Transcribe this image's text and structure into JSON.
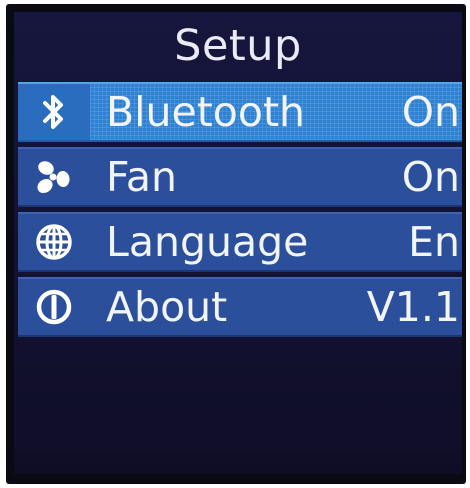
{
  "screen": {
    "title": "Setup"
  },
  "menu": {
    "items": [
      {
        "label": "Bluetooth",
        "value": "On",
        "icon": "bluetooth-icon",
        "selected": true
      },
      {
        "label": "Fan",
        "value": "On",
        "icon": "fan-icon",
        "selected": false
      },
      {
        "label": "Language",
        "value": "En",
        "icon": "globe-icon",
        "selected": false
      },
      {
        "label": "About",
        "value": "V1.1",
        "icon": "info-icon",
        "selected": false
      }
    ]
  },
  "colors": {
    "background": "#131233",
    "item": "#2b4f9a",
    "item_selected": "#2f82d2",
    "text": "#f2f4fb"
  }
}
